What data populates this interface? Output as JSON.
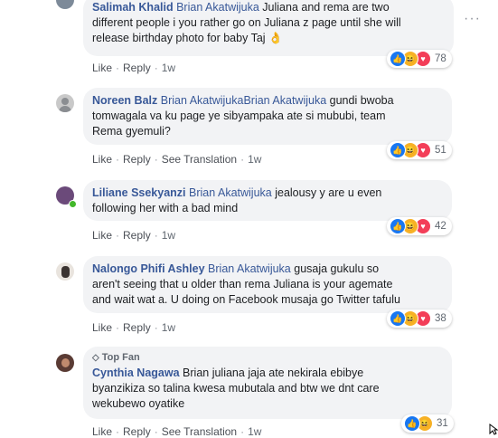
{
  "comments": [
    {
      "author": "Salimah Khalid",
      "mention": "Brian Akatwijuka",
      "text_lines": [
        "Juliana and rema are two",
        "different people i you rather go on Juliana z page until she will",
        "release birthday photo for baby Taj 👌"
      ],
      "actions": {
        "like": "Like",
        "reply": "Reply",
        "time": "1w"
      },
      "reaction_count": "78",
      "reactions": [
        "like-icon",
        "haha-icon",
        "love-icon"
      ]
    },
    {
      "author": "Noreen Balz",
      "mention": "Brian AkatwijukaBrian Akatwijuka",
      "text_lines": [
        "gundi bwoba",
        "tomwagala va ku page ye sibyampaka ate si mububi, team",
        "Rema gyemuli?"
      ],
      "actions": {
        "like": "Like",
        "reply": "Reply",
        "translate": "See Translation",
        "time": "1w"
      },
      "reaction_count": "51",
      "reactions": [
        "like-icon",
        "haha-icon",
        "love-icon"
      ]
    },
    {
      "author": "Liliane Ssekyanzi",
      "mention": "Brian Akatwijuka",
      "text_lines": [
        "jealousy y are u even",
        "following her with a bad mind"
      ],
      "actions": {
        "like": "Like",
        "reply": "Reply",
        "time": "1w"
      },
      "reaction_count": "42",
      "reactions": [
        "like-icon",
        "haha-icon",
        "love-icon"
      ]
    },
    {
      "author": "Nalongo Phifi Ashley",
      "mention": "Brian Akatwijuka",
      "text_lines": [
        "gusaja gukulu so",
        "aren't seeing that u older than rema Juliana is your agemate",
        "and wait wat a. U doing on Facebook musaja go Twitter tafulu"
      ],
      "actions": {
        "like": "Like",
        "reply": "Reply",
        "time": "1w"
      },
      "reaction_count": "38",
      "reactions": [
        "like-icon",
        "haha-icon",
        "love-icon"
      ]
    },
    {
      "badge": "Top Fan",
      "author": "Cynthia Nagawa",
      "mention": "",
      "text_lines": [
        "Brian juliana jaja ate nekirala ebibye",
        "byanzikiza so talina kwesa mubutala and btw we dnt care",
        "wekubewo oyatike"
      ],
      "actions": {
        "like": "Like",
        "reply": "Reply",
        "translate": "See Translation",
        "time": "1w"
      },
      "reaction_count": "31",
      "reactions": [
        "like-icon",
        "haha-icon"
      ]
    }
  ],
  "colors": {
    "link": "#385898",
    "bubble": "#f2f3f5",
    "like": "#1877f2",
    "haha": "#f7b125",
    "love": "#f33e58",
    "online": "#42b72a"
  },
  "menu_icon": "more-options-icon",
  "top_fan_icon": "diamond-badge-icon"
}
